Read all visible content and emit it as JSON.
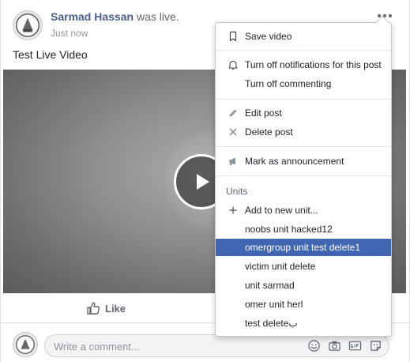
{
  "post": {
    "author": "Sarmad Hassan",
    "action": "was live.",
    "timestamp": "Just now",
    "text": "Test Live Video"
  },
  "actions": {
    "like_label": "Like"
  },
  "comment": {
    "placeholder": "Write a comment..."
  },
  "menu": {
    "save_video": "Save video",
    "turn_off_notifications": "Turn off notifications for this post",
    "turn_off_commenting": "Turn off commenting",
    "edit_post": "Edit post",
    "delete_post": "Delete post",
    "mark_announcement": "Mark as announcement",
    "units_header": "Units",
    "add_to_new_unit": "Add to new unit...",
    "units": [
      "noobs unit hacked12",
      "omergroup unit test delete1",
      "victim unit delete",
      "unit sarmad",
      "omer unit herl",
      "test deleteب"
    ],
    "selected_unit_index": 1
  },
  "colors": {
    "brand": "#4267b2",
    "author_link": "#4b5f8a",
    "secondary_text": "#90949c"
  }
}
